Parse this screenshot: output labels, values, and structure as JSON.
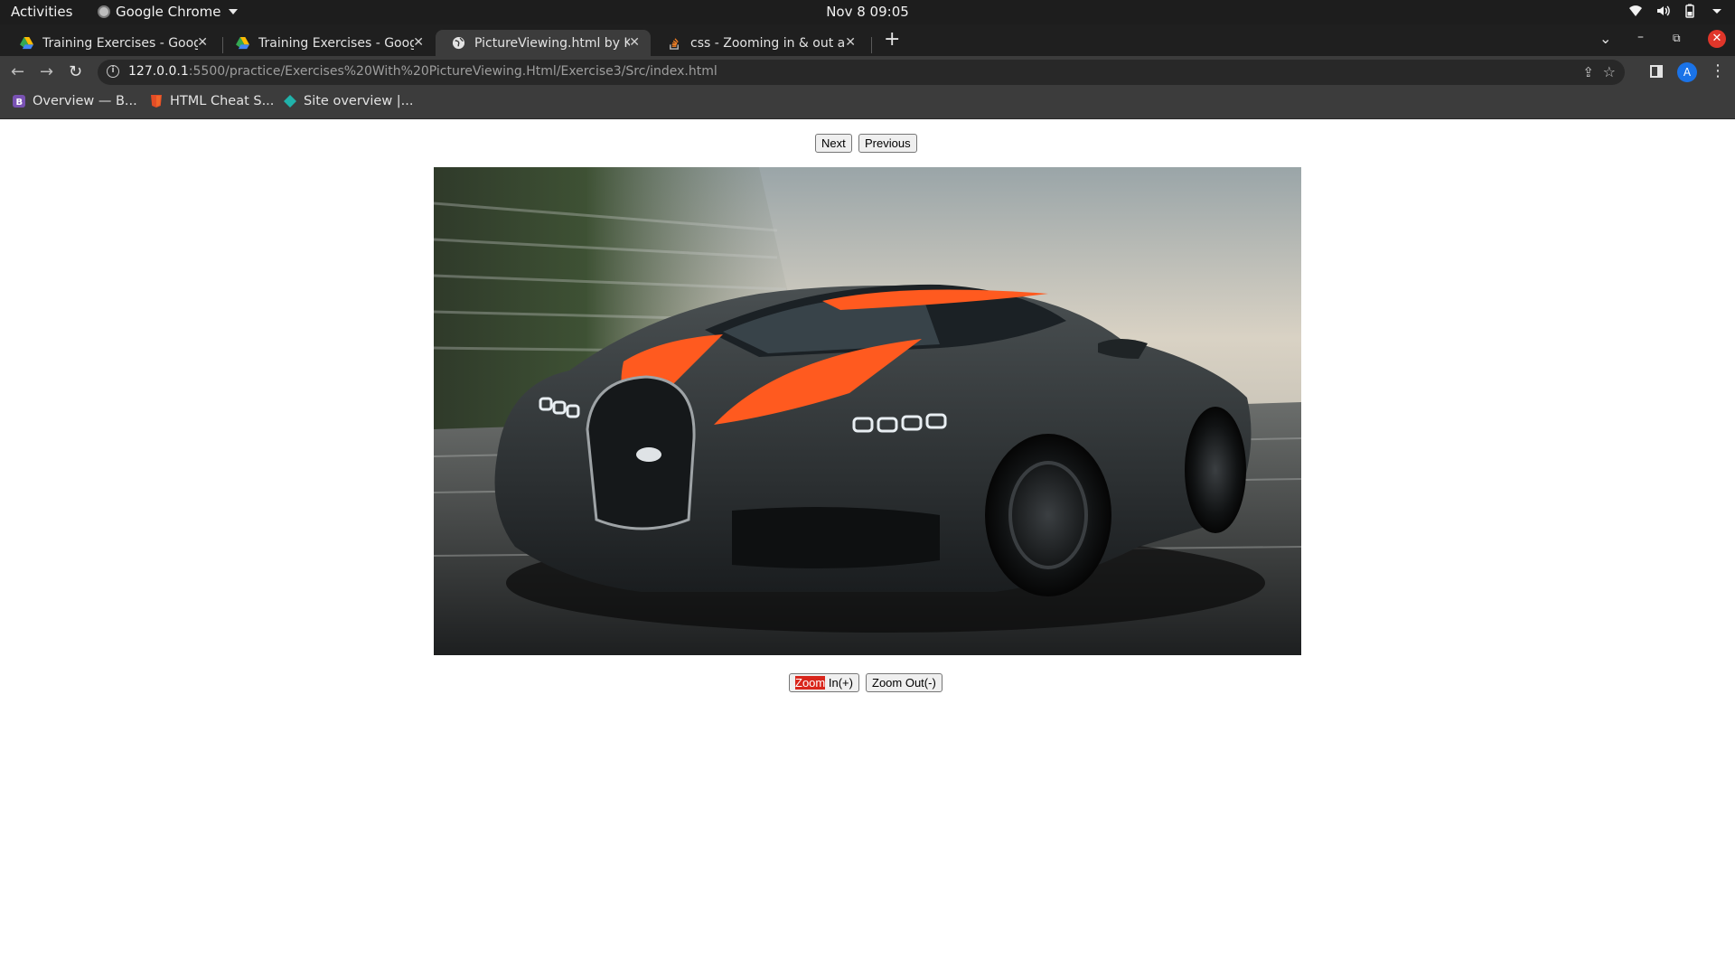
{
  "system": {
    "activities": "Activities",
    "app_name": "Google Chrome",
    "clock": "Nov 8  09:05"
  },
  "tabs": [
    {
      "title": "Training Exercises - Googl",
      "icon": "google-drive-icon",
      "active": false
    },
    {
      "title": "Training Exercises - Googl",
      "icon": "google-drive-icon",
      "active": false
    },
    {
      "title": "PictureViewing.html by K",
      "icon": "globe-icon",
      "active": true
    },
    {
      "title": "css - Zooming in & out an",
      "icon": "stackoverflow-icon",
      "active": false
    }
  ],
  "omnibox": {
    "host": "127.0.0.1",
    "path": ":5500/practice/Exercises%20With%20PictureViewing.Html/Exercise3/Src/index.html"
  },
  "profile_initial": "A",
  "bookmarks": [
    {
      "label": "Overview — B...",
      "icon": "bootstrap-icon"
    },
    {
      "label": "HTML Cheat S...",
      "icon": "html5-icon"
    },
    {
      "label": "Site overview |...",
      "icon": "netlify-icon"
    }
  ],
  "page": {
    "next_label": "Next",
    "previous_label": "Previous",
    "image_alt": "Black and orange Bugatti Chiron sports car driving on a road",
    "zoom_in_highlight": "Zoom",
    "zoom_in_rest": " In(+)",
    "zoom_out_label": "Zoom Out(-)"
  },
  "colors": {
    "highlight": "#d9261c",
    "car_stripe": "#ff5a1f",
    "chrome_dark": "#3c3c3c"
  }
}
